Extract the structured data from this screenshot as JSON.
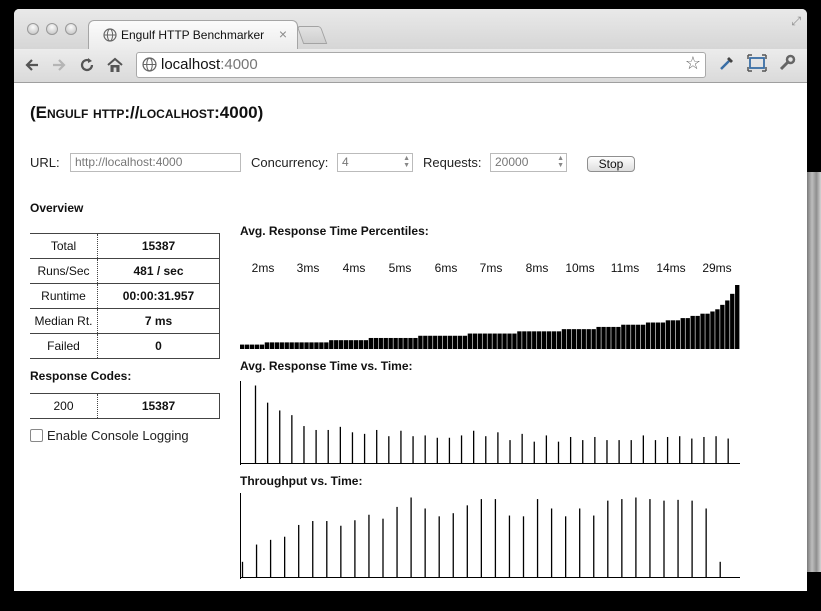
{
  "browser": {
    "tab_title": "Engulf HTTP Benchmarker",
    "tab_close": "×",
    "url_host": "localhost",
    "url_port": ":4000"
  },
  "app": {
    "title": "(Engulf http://localhost:4000)"
  },
  "controls": {
    "url_label": "URL:",
    "url_placeholder": "http://localhost:4000",
    "concurrency_label": "Concurrency:",
    "concurrency_value": "4",
    "requests_label": "Requests:",
    "requests_value": "20000",
    "stop_label": "Stop"
  },
  "overview": {
    "heading": "Overview",
    "rows": [
      {
        "label": "Total",
        "value": "15387"
      },
      {
        "label": "Runs/Sec",
        "value": "481 / sec"
      },
      {
        "label": "Runtime",
        "value": "00:00:31.957"
      },
      {
        "label": "Median Rt.",
        "value": "7 ms"
      },
      {
        "label": "Failed",
        "value": "0"
      }
    ]
  },
  "response_codes": {
    "heading": "Response Codes:",
    "rows": [
      {
        "code": "200",
        "count": "15387"
      }
    ]
  },
  "console_logging": {
    "label": "Enable Console Logging",
    "checked": false
  },
  "charts": {
    "percentiles_title": "Avg. Response Time Percentiles:",
    "percentile_labels": [
      "2ms",
      "3ms",
      "4ms",
      "5ms",
      "6ms",
      "7ms",
      "8ms",
      "10ms",
      "11ms",
      "14ms",
      "29ms"
    ],
    "rt_vs_time_title": "Avg. Response Time vs. Time:",
    "throughput_title": "Throughput vs. Time:"
  },
  "chart_data": [
    {
      "type": "bar",
      "title": "Avg. Response Time Percentiles:",
      "tick_labels": [
        "2ms",
        "3ms",
        "4ms",
        "5ms",
        "6ms",
        "7ms",
        "8ms",
        "10ms",
        "11ms",
        "14ms",
        "29ms"
      ],
      "values": [
        2,
        2,
        2,
        2,
        2,
        3,
        3,
        3,
        3,
        3,
        3,
        3,
        3,
        3,
        3,
        3,
        3,
        3,
        4,
        4,
        4,
        4,
        4,
        4,
        4,
        4,
        5,
        5,
        5,
        5,
        5,
        5,
        5,
        5,
        5,
        5,
        6,
        6,
        6,
        6,
        6,
        6,
        6,
        6,
        6,
        6,
        7,
        7,
        7,
        7,
        7,
        7,
        7,
        7,
        7,
        7,
        8,
        8,
        8,
        8,
        8,
        8,
        8,
        8,
        8,
        9,
        9,
        9,
        9,
        9,
        9,
        9,
        10,
        10,
        10,
        10,
        10,
        11,
        11,
        11,
        11,
        11,
        12,
        12,
        12,
        12,
        13,
        13,
        13,
        14,
        14,
        15,
        15,
        16,
        16,
        17,
        18,
        20,
        22,
        25,
        29
      ]
    },
    {
      "type": "bar",
      "title": "Avg. Response Time vs. Time:",
      "values": [
        100,
        78,
        68,
        62,
        48,
        43,
        43,
        47,
        40,
        38,
        43,
        35,
        42,
        35,
        36,
        33,
        33,
        36,
        42,
        35,
        40,
        30,
        38,
        28,
        36,
        28,
        34,
        30,
        34,
        30,
        30,
        30,
        36,
        30,
        34,
        35,
        32,
        34,
        35,
        32
      ]
    },
    {
      "type": "bar",
      "title": "Throughput vs. Time:",
      "values": [
        20,
        42,
        48,
        52,
        67,
        72,
        72,
        66,
        73,
        80,
        75,
        90,
        102,
        88,
        78,
        82,
        92,
        100,
        100,
        79,
        78,
        100,
        88,
        78,
        88,
        79,
        98,
        100,
        102,
        100,
        98,
        99,
        98,
        88,
        20
      ]
    }
  ]
}
